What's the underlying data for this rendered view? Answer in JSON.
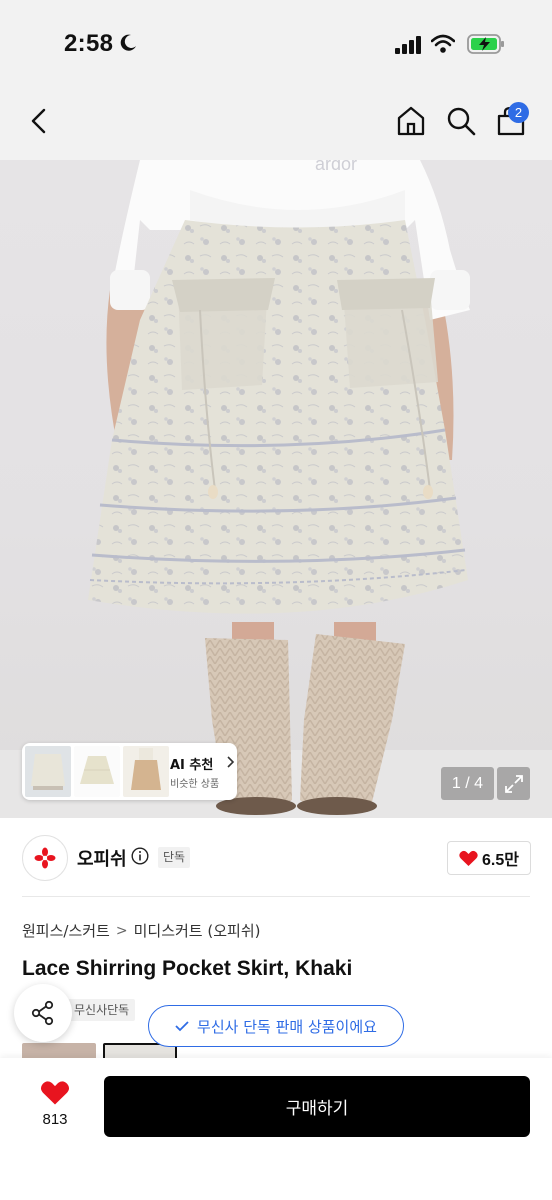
{
  "status_bar": {
    "time": "2:58"
  },
  "header": {
    "cart_count": "2"
  },
  "gallery": {
    "counter": "1 / 4",
    "ai": {
      "title": "AI 추천",
      "subtitle": "비슷한 상품"
    }
  },
  "brand": {
    "name": "오피쉬",
    "tag": "단독",
    "likes": "6.5만"
  },
  "product": {
    "breadcrumb": [
      "원피스/스커트",
      "미디스커트 (오피쉬)"
    ],
    "title": "Lace Shirring Pocket Skirt, Khaki",
    "badge": "무신사단독",
    "exclusive_notice": "무신사 단독 판매 상품이에요"
  },
  "bottom": {
    "wish_count": "813",
    "buy_label": "구매하기"
  },
  "colors": {
    "accent_blue": "#2f6ce5",
    "heart_red": "#e8141f",
    "buy_button": "#000000"
  },
  "icons": [
    "moon-icon",
    "signal-icon",
    "wifi-icon",
    "battery-icon",
    "back-icon",
    "home-icon",
    "search-icon",
    "cart-icon",
    "chevron-right-icon",
    "expand-icon",
    "info-icon",
    "heart-icon",
    "share-icon",
    "check-icon"
  ]
}
